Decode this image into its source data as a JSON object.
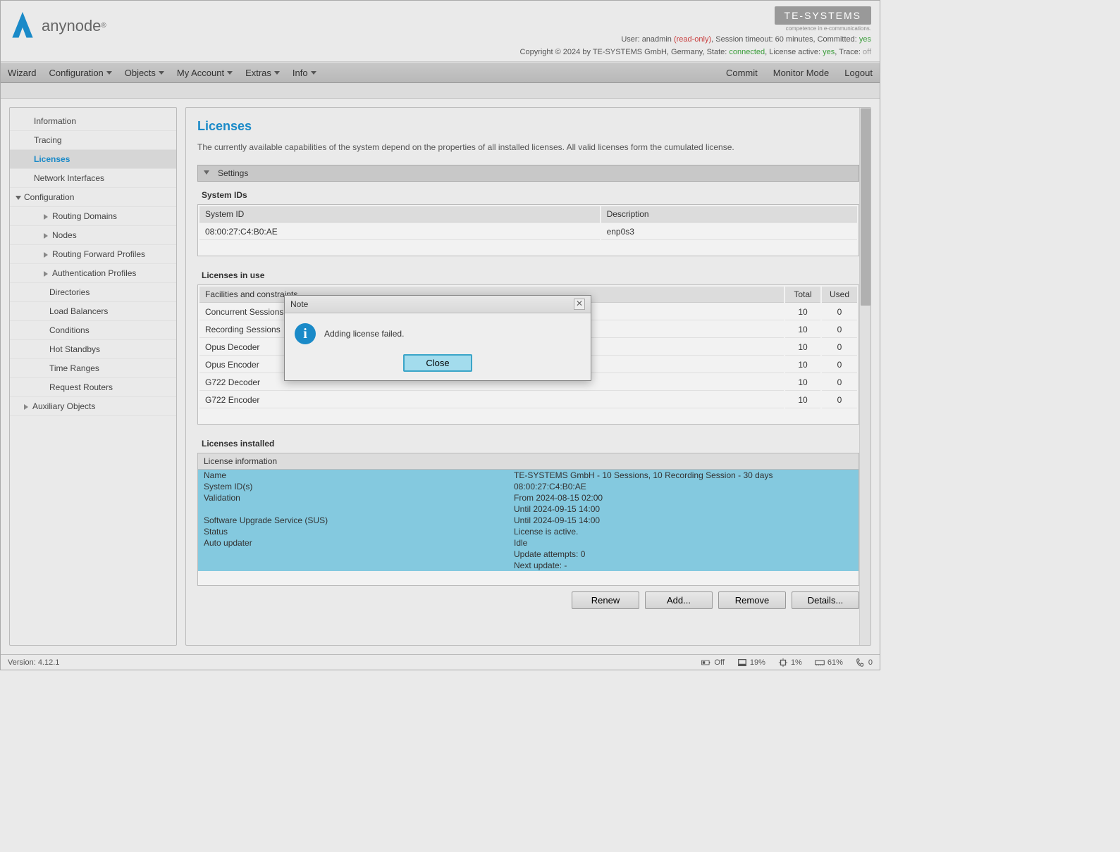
{
  "brand": {
    "name": "anynode",
    "reg": "®"
  },
  "vendor": {
    "name": "TE-SYSTEMS",
    "tagline": "competence in e-communications."
  },
  "header_status": {
    "user_label": "User:",
    "user": "anadmin",
    "readonly": "(read-only)",
    "session_label": ", Session timeout:",
    "session": "60 minutes",
    "committed_label": ", Committed:",
    "committed": "yes",
    "copyright": "Copyright © 2024 by TE-SYSTEMS GmbH, Germany, State:",
    "state": "connected",
    "lic_label": ", License active:",
    "lic": "yes",
    "trace_label": ", Trace:",
    "trace": "off"
  },
  "menu": {
    "left": [
      "Wizard",
      "Configuration",
      "Objects",
      "My Account",
      "Extras",
      "Info"
    ],
    "right": [
      "Commit",
      "Monitor Mode",
      "Logout"
    ]
  },
  "sidebar": [
    {
      "label": "Information",
      "indent": 0
    },
    {
      "label": "Tracing",
      "indent": 0
    },
    {
      "label": "Licenses",
      "indent": 0,
      "active": true
    },
    {
      "label": "Network Interfaces",
      "indent": 0
    },
    {
      "label": "Configuration",
      "indent": 0,
      "expandable": true,
      "open": true
    },
    {
      "label": "Routing Domains",
      "indent": 1,
      "arrow": true
    },
    {
      "label": "Nodes",
      "indent": 1,
      "arrow": true
    },
    {
      "label": "Routing Forward Profiles",
      "indent": 1,
      "arrow": true
    },
    {
      "label": "Authentication Profiles",
      "indent": 1,
      "arrow": true
    },
    {
      "label": "Directories",
      "indent": 2
    },
    {
      "label": "Load Balancers",
      "indent": 2
    },
    {
      "label": "Conditions",
      "indent": 2
    },
    {
      "label": "Hot Standbys",
      "indent": 2
    },
    {
      "label": "Time Ranges",
      "indent": 2
    },
    {
      "label": "Request Routers",
      "indent": 2
    },
    {
      "label": "Auxiliary Objects",
      "indent": 0,
      "expandable": true,
      "arrow": true
    }
  ],
  "page": {
    "title": "Licenses",
    "desc": "The currently available capabilities of the system depend on the properties of all installed licenses. All valid licenses form the cumulated license.",
    "settings_header": "Settings",
    "system_ids_title": "System IDs",
    "system_ids_cols": [
      "System ID",
      "Description"
    ],
    "system_ids_rows": [
      [
        "08:00:27:C4:B0:AE",
        "enp0s3"
      ]
    ],
    "inuse_title": "Licenses in use",
    "inuse_cols": [
      "Facilities and constraints",
      "Total",
      "Used"
    ],
    "inuse_rows": [
      [
        "Concurrent Sessions",
        "10",
        "0"
      ],
      [
        "Recording Sessions",
        "10",
        "0"
      ],
      [
        "Opus Decoder",
        "10",
        "0"
      ],
      [
        "Opus Encoder",
        "10",
        "0"
      ],
      [
        "G722 Decoder",
        "10",
        "0"
      ],
      [
        "G722 Encoder",
        "10",
        "0"
      ]
    ],
    "installed_title": "Licenses installed",
    "installed_header": "License information",
    "installed_info": [
      [
        "Name",
        "TE-SYSTEMS GmbH - 10 Sessions, 10 Recording Session - 30 days"
      ],
      [
        "System ID(s)",
        "08:00:27:C4:B0:AE"
      ],
      [
        "Validation",
        "From 2024-08-15 02:00"
      ],
      [
        "",
        "Until 2024-09-15 14:00"
      ],
      [
        "Software Upgrade Service (SUS)",
        "Until 2024-09-15 14:00"
      ],
      [
        "Status",
        "License is active."
      ],
      [
        "Auto updater",
        "Idle"
      ],
      [
        "",
        "Update attempts: 0"
      ],
      [
        "",
        "Next update: -"
      ]
    ],
    "buttons": [
      "Renew",
      "Add...",
      "Remove",
      "Details..."
    ]
  },
  "modal": {
    "title": "Note",
    "message": "Adding license failed.",
    "close": "Close"
  },
  "footer": {
    "version_label": "Version:",
    "version": "4.12.1",
    "stats": [
      {
        "icon": "battery",
        "val": "Off"
      },
      {
        "icon": "disk",
        "val": "19%"
      },
      {
        "icon": "cpu",
        "val": "1%"
      },
      {
        "icon": "mem",
        "val": "61%"
      },
      {
        "icon": "phone",
        "val": "0"
      }
    ]
  }
}
